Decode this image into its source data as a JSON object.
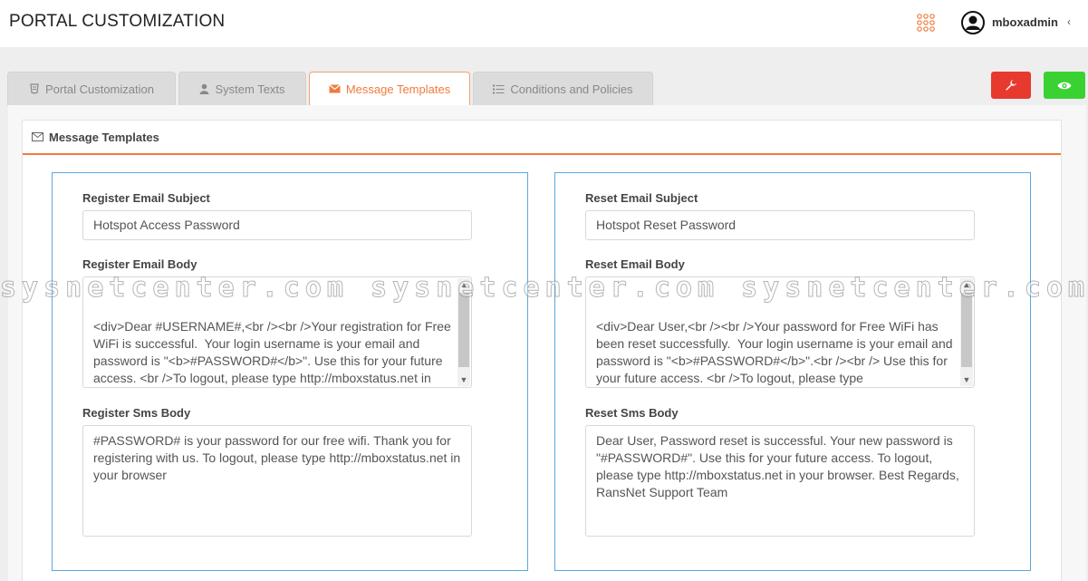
{
  "header": {
    "title": "PORTAL CUSTOMIZATION",
    "apps_icon": "grid-dots-icon",
    "username": "mboxadmin",
    "collapse_icon": "chevron-left-icon",
    "accent_color": "#f07b3c"
  },
  "tabs": [
    {
      "label": "Portal Customization",
      "icon": "css3-icon",
      "active": false
    },
    {
      "label": "System Texts",
      "icon": "user-icon",
      "active": false
    },
    {
      "label": "Message Templates",
      "icon": "envelope-icon",
      "active": true
    },
    {
      "label": "Conditions and Policies",
      "icon": "list-icon",
      "active": false
    }
  ],
  "actions": {
    "settings_icon": "wrench-icon",
    "settings_color": "#e8392f",
    "preview_icon": "eye-icon",
    "preview_color": "#39d232"
  },
  "panel": {
    "title": "Message Templates",
    "icon": "envelope-icon"
  },
  "register": {
    "subject_label": "Register Email Subject",
    "subject_value": "Hotspot Access Password",
    "body_label": "Register Email Body",
    "body_value": "<div>Dear #USERNAME#,<br /><br />Your registration for Free WiFi is successful.  Your login username is your email and password is \"<b>#PASSWORD#</b>\". Use this for your future access. <br />To logout, please type http://mboxstatus.net in your browser. <br /><br />Best Regards,<br />RansNet Support Team<br /></div>",
    "sms_label": "Register Sms Body",
    "sms_value": "#PASSWORD# is your password for our free wifi. Thank you for registering with us. To logout, please type http://mboxstatus.net in your browser"
  },
  "reset": {
    "subject_label": "Reset Email Subject",
    "subject_value": "Hotspot Reset Password",
    "body_label": "Reset Email Body",
    "body_value": "<div>Dear User,<br /><br />Your password for Free WiFi has been reset successfully.  Your login username is your email and password is \"<b>#PASSWORD#</b>\".<br /><br /> Use this for your future access. <br />To logout, please type http://mboxstatus.net in your browser. <br /><br />Best Regards,<br />RansNet Support Team<br /></div>",
    "sms_label": "Reset Sms Body",
    "sms_value": "Dear User, Password reset is successful. Your new password is \"#PASSWORD#\". Use this for your future access. To logout, please type http://mboxstatus.net in your browser. Best Regards, RansNet Support Team"
  },
  "watermark": "sysnetcenter.com   sysnetcenter.com   sysnetcenter.com   sys"
}
